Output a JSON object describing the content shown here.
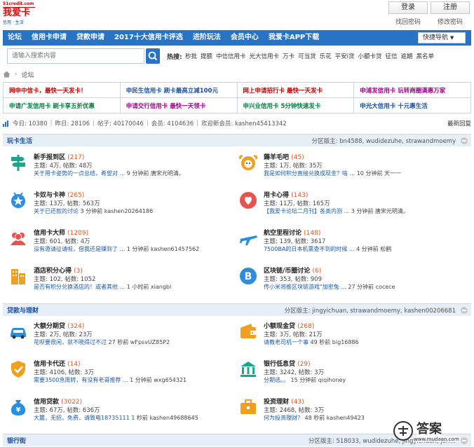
{
  "logo": {
    "domain": "51credit.com",
    "name": "我爱卡",
    "slogan": "信用 · 生活"
  },
  "auth": {
    "login": "登录",
    "register": "注册",
    "find_pwd": "找回密码",
    "change_pwd": "修改密码"
  },
  "nav": {
    "items": [
      "论坛",
      "信用卡申请",
      "贷款申请",
      "2017十大信用卡评选",
      "进阶玩法",
      "会员中心",
      "我爱卡APP下载"
    ],
    "quick": "快捷导航"
  },
  "search": {
    "placeholder": "请输入搜索内容",
    "hot_label": "热搜:",
    "hot": [
      "秒批",
      "提额",
      "中信信用卡",
      "光大信用卡",
      "万卡",
      "可当贷",
      "乐花",
      "平安i贷",
      "小额卡贷",
      "征信",
      "逾期",
      "黑名单"
    ]
  },
  "breadcrumb": {
    "current": "论坛"
  },
  "ads": [
    {
      "text": "网申中信卡，最快一天发卡！",
      "color": "#c00000"
    },
    {
      "text": "申民生信用卡  刷卡最高立减100元",
      "color": "#1a4fa0"
    },
    {
      "text": "网上申请招行卡  最快一天发卡",
      "color": "#c00000"
    },
    {
      "text": "申浦发信用卡  玩转商圈满惠万家",
      "color": "#a0008a"
    },
    {
      "text": "申请广发信用卡  刷卡享五折优惠",
      "color": "#007a3d"
    },
    {
      "text": "申请交行信用卡  最快一天领卡",
      "color": "#a0008a"
    },
    {
      "text": "申兴业信用卡  5分钟快速发卡",
      "color": "#007a3d"
    },
    {
      "text": "申光大信用卡  十元惠生活",
      "color": "#1a4fa0"
    }
  ],
  "stats": {
    "today": "今日: 10380",
    "yesterday": "昨日: 28106",
    "posts": "帖子: 40170046",
    "members": "会员: 4104636",
    "welcome": "欢迎新会员: kashen45413342",
    "newest": "最新回复"
  },
  "sections": [
    {
      "title": "玩卡生活",
      "mods": "分区版主: bn4588, wudidezuhe, strawandmoemy",
      "forums": [
        {
          "name": "新手报到区",
          "count": "(217)",
          "stats": "主题: 4万, 帖数: 48万",
          "last_title": "关于用卡姿势的一点总结，希望对 ...",
          "last_meta": "9 分钟前 唐宋元明清。",
          "icon": "signpost-icon",
          "color": "#1aa88c"
        },
        {
          "name": "薅羊毛吧",
          "count": "(45)",
          "stats": "主题: 1万, 帖数: 35万",
          "last_title": "我是如何积分直接兑换成现金？啥 ...",
          "last_meta": "10 分钟前 天一一",
          "icon": "sheep-icon",
          "color": "#f0a020"
        },
        {
          "name": "卡奴与卡神",
          "count": "(265)",
          "stats": "主题: 13万, 帖数: 563万",
          "last_title": "关于已还款的讨论",
          "last_meta": "3 分钟前 kashen20264186",
          "icon": "star-badge-icon",
          "color": "#2b8ee0"
        },
        {
          "name": "用卡心得",
          "count": "(143)",
          "stats": "主题: 11万, 帖数: 165万",
          "last_title": "【我爱卡论坛二月刊】各类内测 ...",
          "last_meta": "3 分钟前 唐宋元明清。",
          "icon": "heart-icon",
          "color": "#e8534f"
        },
        {
          "name": "信用卡大师",
          "count": "(1209)",
          "stats": "主题: 601, 帖数: 4万",
          "last_title": "没有邀请征请啦，但我还是赚到了 ...",
          "last_meta": "1 分钟前 kashen61457562",
          "icon": "users-icon",
          "color": "#e8534f"
        },
        {
          "name": "航空里程讨论",
          "count": "(148)",
          "stats": "主题: 139, 帖数: 3617",
          "last_title": "7500BA的日本机票查不到的时候 ...",
          "last_meta": "4 分钟前 松鹤",
          "icon": "airplane-icon",
          "color": "#2b8ee0"
        },
        {
          "name": "酒店积分心得",
          "count": "(3)",
          "stats": "主题: 102, 帖数: 1052",
          "last_title": "是否有积分兑换酒店的！或者其他 ...",
          "last_meta": "1 小时前 xiangbl",
          "icon": "hotel-icon",
          "color": "#f0a020"
        },
        {
          "name": "区块链/币圈讨论",
          "count": "(6)",
          "stats": "主题: 353, 帖数: 909",
          "last_title": "传小米将推区块链游戏\"加密兔 ...",
          "last_meta": "27 分钟前 cocece",
          "icon": "bitcoin-icon",
          "color": "#2b8ee0"
        }
      ]
    },
    {
      "title": "贷款与理财",
      "mods": "分区版主: jingyichuan, strawandmoemy, kashen00206681",
      "forums": [
        {
          "name": "大额分期贷",
          "count": "(324)",
          "stats": "主题: 2万, 帖数: 23万",
          "last_title": "花呗要很闲，就不晓得过不过",
          "last_meta": "27 秒前 wFpsvUZ85P2",
          "icon": "car-icon",
          "color": "#2b8ee0"
        },
        {
          "name": "小额现金贷",
          "count": "(268)",
          "stats": "主题: 3万, 帖数: 21万",
          "last_title": "请教老司机一个事",
          "last_meta": "49 秒前 big16886",
          "icon": "wallet-icon",
          "color": "#f0a020"
        },
        {
          "name": "信用卡代还",
          "count": "(14)",
          "stats": "主题: 4106, 帖数: 3万",
          "last_title": "需要3500急周转，有没有老哥推荐 ...",
          "last_meta": "1 分钟前 wxg654321",
          "icon": "shield-icon",
          "color": "#f0a020"
        },
        {
          "name": "银行低息贷",
          "count": "(29)",
          "stats": "主题: 3242, 帖数: 3万",
          "last_title": "分期逃。。",
          "last_meta": "15 分钟前 qiqihoney",
          "icon": "bank-icon",
          "color": "#1aa88c"
        },
        {
          "name": "信用贷款",
          "count": "(3022)",
          "stats": "主题: 67万, 帖数: 636万",
          "last_title": "大麓，无招，免费，请致电18735111",
          "last_meta": "1 秒前 kashen49688645",
          "icon": "money-bag-icon",
          "color": "#2b8ee0"
        },
        {
          "name": "投资理财",
          "count": "(43)",
          "stats": "主题: 2468, 帖数: 3万",
          "last_title": "何为投资理财？",
          "last_meta": "48 秒前 kashen49423",
          "icon": "briefcase-icon",
          "color": "#f0a020"
        }
      ]
    },
    {
      "title": "银行街",
      "mods": "分区版主: 518033, wudidezuhe, jingyichuan, jerr...",
      "forums": []
    }
  ],
  "watermark": {
    "text": "答案",
    "sub": "www.mudaan.com"
  }
}
